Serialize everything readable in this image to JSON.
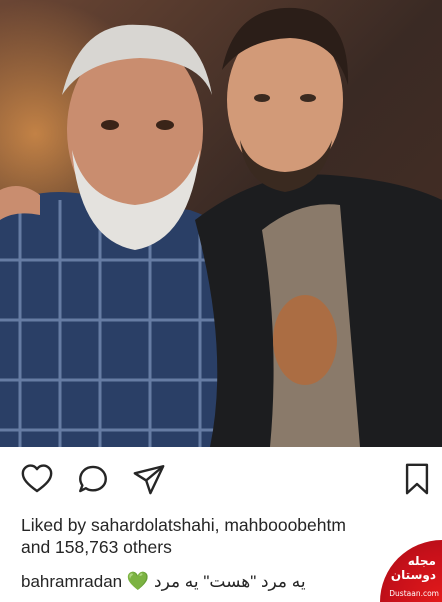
{
  "post": {
    "photo_alt": "photo",
    "likes": {
      "prefix": "Liked by ",
      "users": "sahardolatshahi, mahbooobehtm",
      "line2": "and 158,763 others"
    },
    "caption": {
      "username": "bahramradan",
      "text": "یه مرد \"هست\" یه مرد",
      "emoji": "💚"
    }
  },
  "actions": {
    "like_icon": "heart-outline-icon",
    "comment_icon": "comment-bubble-icon",
    "share_icon": "paper-plane-icon",
    "save_icon": "bookmark-icon"
  },
  "watermark": {
    "title": "مجله دوستان",
    "site": "Dustaan.com"
  },
  "colors": {
    "text": "#262626",
    "heart_green": "#39d353",
    "watermark_red": "#d0141c"
  }
}
